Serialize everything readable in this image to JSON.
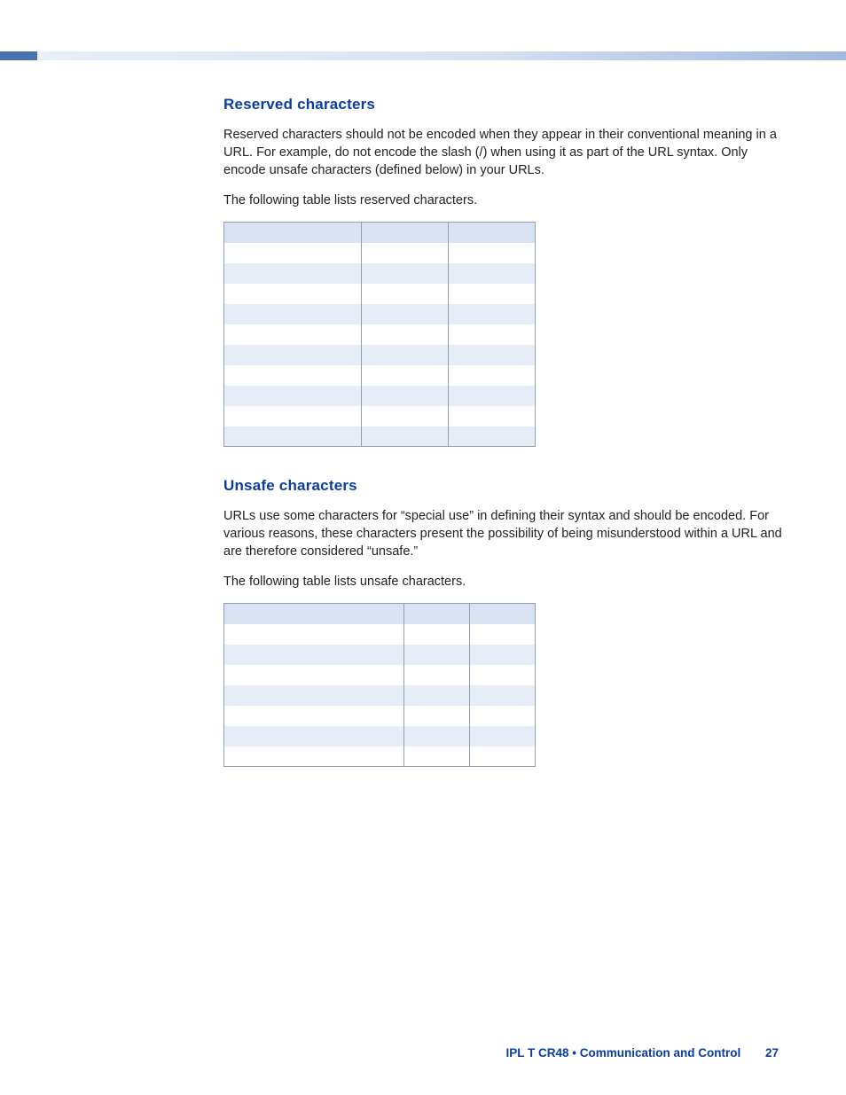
{
  "section1": {
    "heading": "Reserved characters",
    "para1": "Reserved characters should not be encoded when they appear in their conventional meaning in a URL. For example, do not encode the slash (/) when using it as part of the URL syntax. Only encode unsafe characters (defined below) in your URLs.",
    "para2": "The following table lists reserved characters."
  },
  "section2": {
    "heading": "Unsafe characters",
    "para1": "URLs use some characters for “special use” in defining their syntax and should be encoded. For various reasons, these characters present the possibility of being misunderstood within a URL and are therefore considered “unsafe.”",
    "para2": "The following table lists unsafe characters."
  },
  "footer": {
    "product": "IPL T CR48 • Communication and Control",
    "page": "27"
  }
}
